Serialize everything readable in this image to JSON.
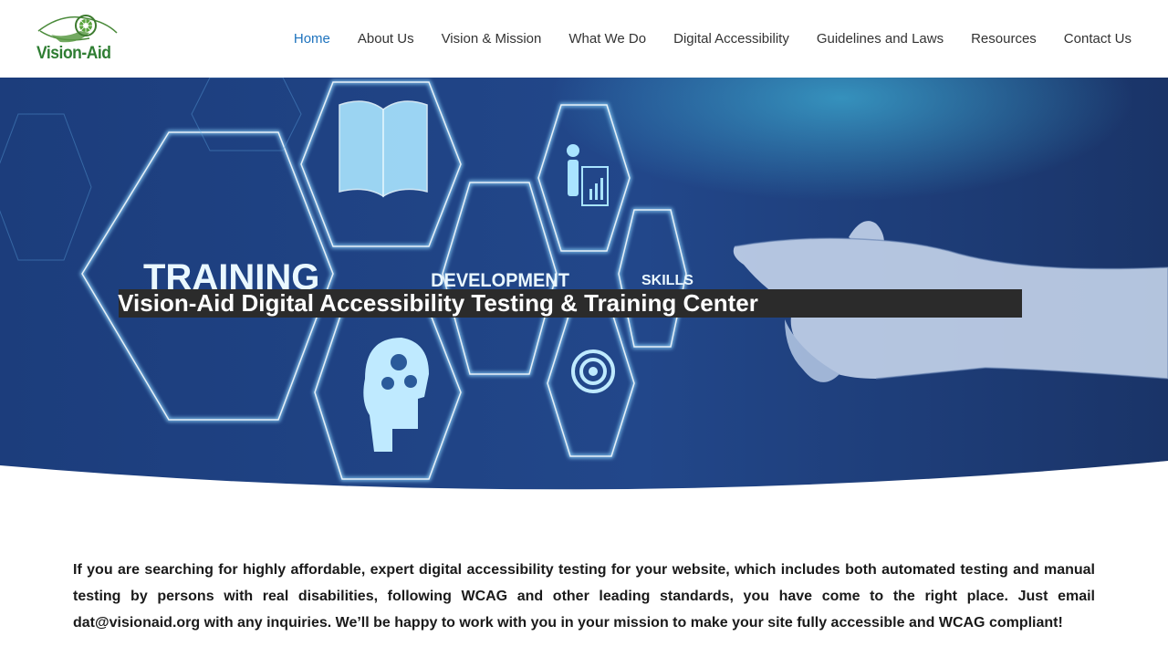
{
  "logo": {
    "text": "Vision-Aid",
    "icon": "eye-icon"
  },
  "nav": {
    "items": [
      {
        "label": "Home",
        "active": true
      },
      {
        "label": "About Us"
      },
      {
        "label": "Vision & Mission"
      },
      {
        "label": "What We Do"
      },
      {
        "label": "Digital Accessibility"
      },
      {
        "label": "Guidelines and Laws"
      },
      {
        "label": "Resources"
      },
      {
        "label": "Contact Us"
      }
    ]
  },
  "hero": {
    "title": "Vision-Aid Digital Accessibility Testing & Training Center",
    "image_labels": {
      "training": "TRAINING",
      "development": "DEVELOPMENT",
      "skills": "SKILLS"
    }
  },
  "intro": {
    "text": "If you are searching for highly affordable, expert digital accessibility testing for your website, which includes both automated testing and manual testing by persons with real disabilities, following WCAG and other leading standards, you have come to the right place. Just email dat@visionaid.org with any inquiries. We’ll be happy to work with you in your mission to make your site fully accessible and WCAG compliant!"
  },
  "colors": {
    "nav_active": "#1e73be",
    "nav_text": "#333333",
    "logo_green": "#2e7d32",
    "hero_blue": "#1f3f7a",
    "banner_bg": "#2b2b2b"
  }
}
